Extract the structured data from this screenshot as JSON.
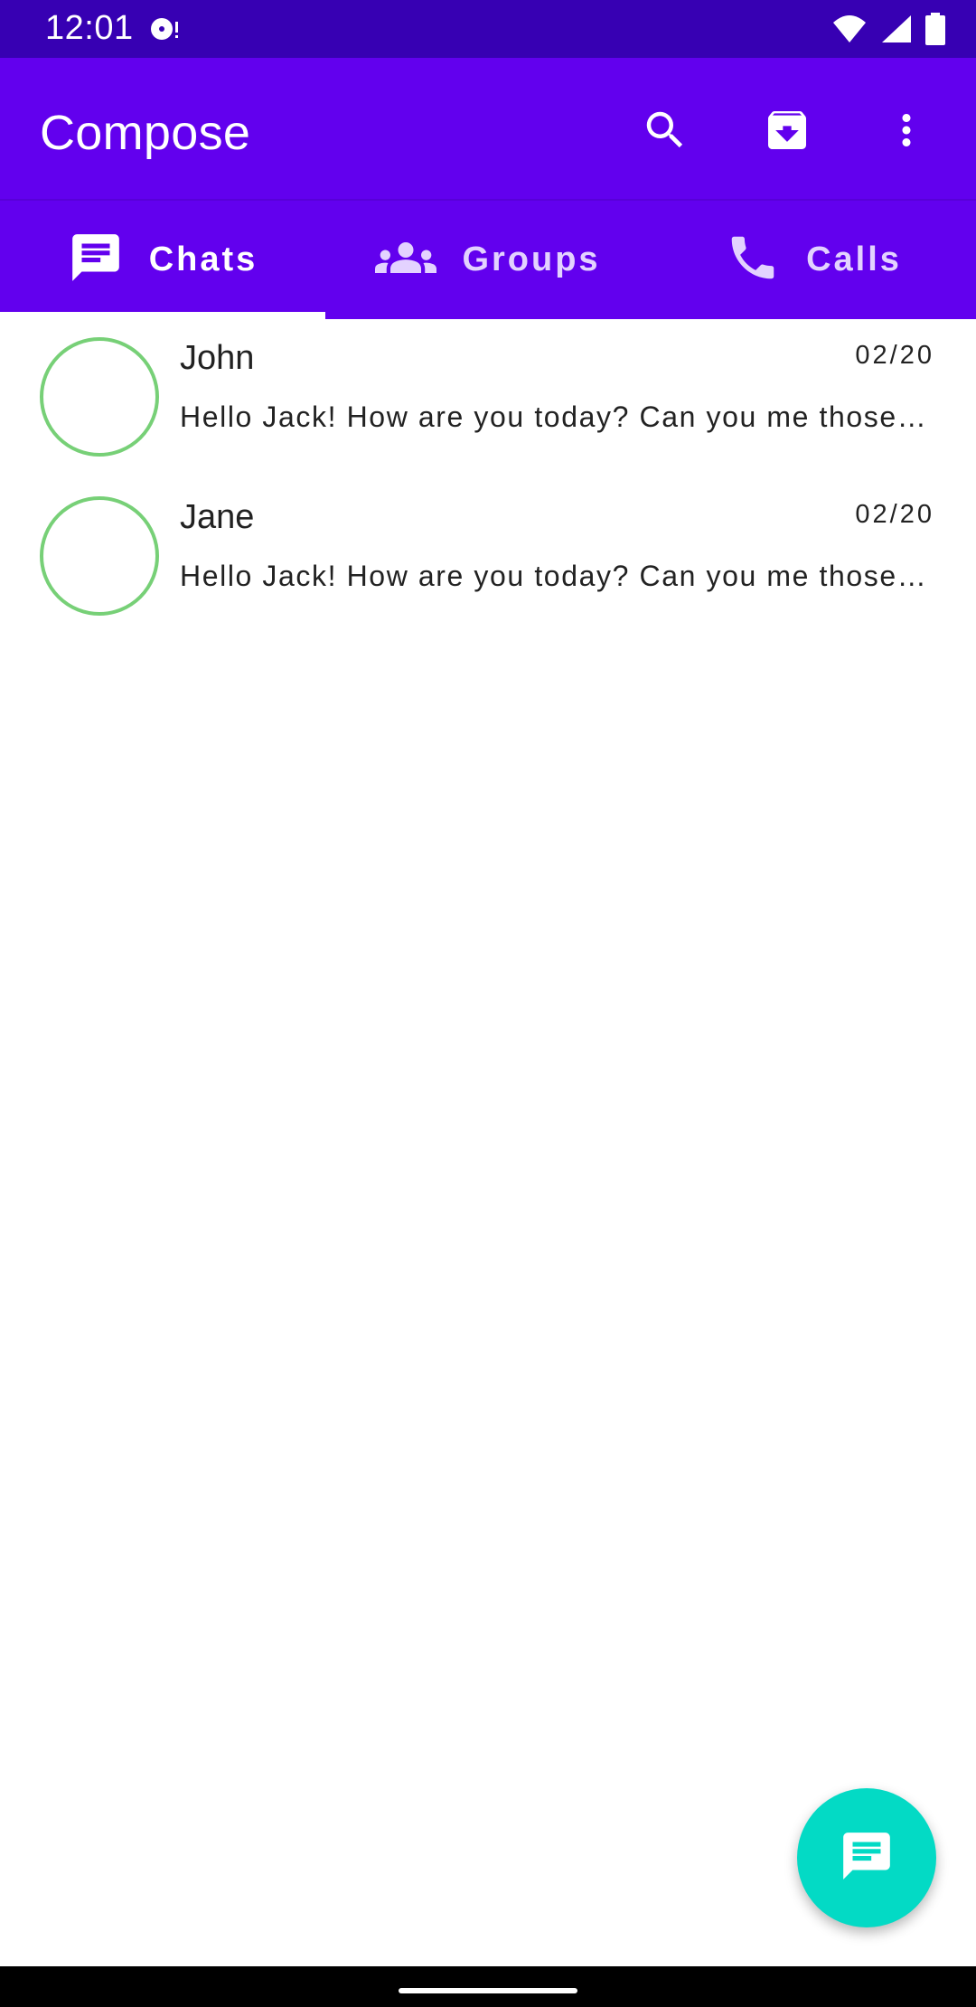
{
  "status_bar": {
    "time": "12:01"
  },
  "app_bar": {
    "title": "Compose",
    "icons": [
      "search-icon",
      "archive-icon",
      "more-vert-icon"
    ]
  },
  "tabs": [
    {
      "label": "Chats",
      "icon": "chat-icon",
      "selected": true
    },
    {
      "label": "Groups",
      "icon": "groups-icon",
      "selected": false
    },
    {
      "label": "Calls",
      "icon": "phone-icon",
      "selected": false
    }
  ],
  "chats": [
    {
      "name": "John",
      "date": "02/20",
      "message": "Hello Jack! How are you today? Can you me those presentations?"
    },
    {
      "name": "Jane",
      "date": "02/20",
      "message": "Hello Jack! How are you today? Can you me those presentations?"
    }
  ],
  "fab": {
    "icon": "chat-icon"
  },
  "colors": {
    "primary": "#6200ee",
    "primary_dark": "#3700b3",
    "accent": "#03dac5",
    "avatar_ring": "#77d077"
  }
}
